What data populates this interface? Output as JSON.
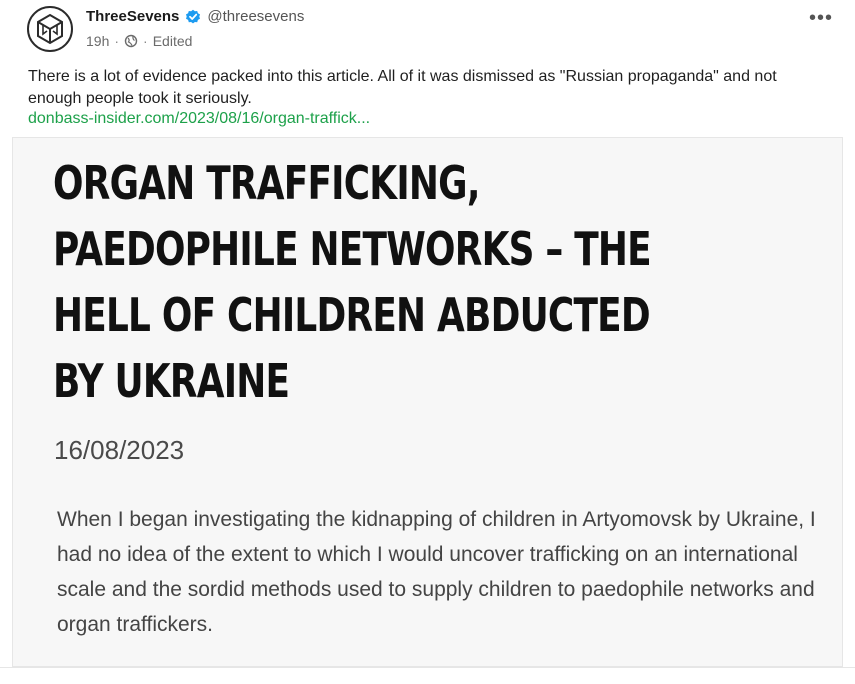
{
  "author": {
    "display_name": "ThreeSevens",
    "handle": "@threesevens",
    "verified": true,
    "avatar_icon": "threesevens-logo-icon"
  },
  "meta": {
    "time": "19h",
    "separator": "·",
    "edited": "Edited",
    "visibility_icon": "globe-icon"
  },
  "post": {
    "text": "There is a lot of evidence packed into this article. All of it was dismissed as \"Russian propaganda\" and not enough people took it seriously.",
    "link": "donbass-insider.com/2023/08/16/organ-traffick..."
  },
  "card": {
    "headline_lines": [
      "ORGAN TRAFFICKING,",
      "PAEDOPHILE NETWORKS – THE",
      "HELL OF CHILDREN ABDUCTED",
      "BY UKRAINE"
    ],
    "date": "16/08/2023",
    "excerpt": "When I began investigating the kidnapping of children in Artyomovsk by Ukraine, I had no idea of the extent to which I would uncover trafficking on an international scale and the sordid methods used to supply children to paedophile networks and organ traffickers."
  },
  "menu": {
    "more_label": "•••"
  },
  "colors": {
    "link": "#1da14a",
    "verified": "#1d9bf0"
  }
}
